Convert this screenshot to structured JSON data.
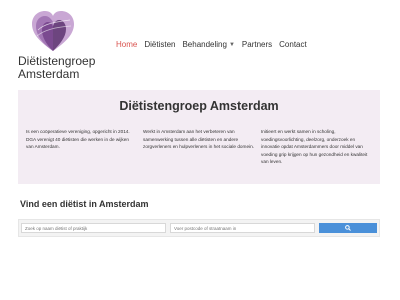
{
  "brand": {
    "line1": "Diëtistengroep",
    "line2": "Amsterdam",
    "colors": {
      "primary": "#8a5a9e",
      "light": "#c9a7d4"
    }
  },
  "nav": {
    "items": [
      {
        "label": "Home",
        "active": true
      },
      {
        "label": "Diëtisten",
        "active": false
      },
      {
        "label": "Behandeling",
        "active": false,
        "dropdown": true
      },
      {
        "label": "Partners",
        "active": false
      },
      {
        "label": "Contact",
        "active": false
      }
    ],
    "active_color": "#d9534f"
  },
  "banner": {
    "title": "Diëtistengroep Amsterdam",
    "col1": "Is een coöperatieve vereniging, opgericht in 2014. DGA verenigt 40 diëtisten die werken in de wijken van Amsterdam.",
    "col2": "Werkt in Amsterdam aan het verbeteren van samenwerking tussen alle diëtisten en andere zorgverleners en hulpverleners in het sociale domein.",
    "col3": "Initieert en werkt samen in scholing, voedingsvoorlichting, deelzorg, onderzoek en innovatie opdat Amsterdammers door middel van voeding grip krijgen op hun gezondheid en kwaliteit van leven.",
    "background": "#f3ecf3"
  },
  "search": {
    "title": "Vind een diëtist in Amsterdam",
    "name_placeholder": "Zoek op naam diëtist of praktijk",
    "postcode_placeholder": "Voer postcode of straatnaam in",
    "button_icon": "search-icon",
    "button_color": "#4a90d9"
  }
}
